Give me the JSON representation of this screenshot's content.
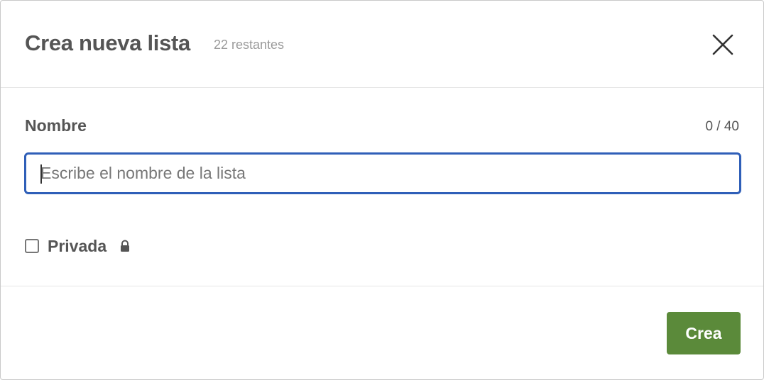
{
  "dialog": {
    "title": "Crea nueva lista",
    "remaining": "22 restantes",
    "close_icon": "close-icon"
  },
  "form": {
    "name_label": "Nombre",
    "counter": "0 / 40",
    "name_value": "",
    "name_placeholder": "Escribe el nombre de la lista",
    "private_label": "Privada",
    "private_checked": false,
    "lock_icon": "lock-icon"
  },
  "footer": {
    "create_label": "Crea"
  },
  "colors": {
    "accent_focus": "#2f5fb8",
    "primary_button": "#5b8a3a",
    "text": "#555555",
    "muted_text": "#9a9a9a"
  }
}
